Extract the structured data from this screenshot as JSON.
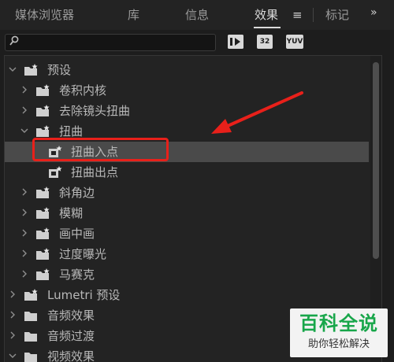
{
  "tabs": [
    {
      "label": "媒体浏览器"
    },
    {
      "label": "库"
    },
    {
      "label": "信息"
    },
    {
      "label": "效果",
      "active": true
    },
    {
      "label": "标记"
    }
  ],
  "icons": {
    "tab_menu": "≡",
    "overflow": "»",
    "search": "⌕",
    "chevron_collapsed": "›",
    "chevron_expanded": "⌄"
  },
  "search": {
    "placeholder": "",
    "value": ""
  },
  "toolbar_buttons": [
    {
      "name": "accelerated-effects-button",
      "label": "▶"
    },
    {
      "name": "32bit-effects-button",
      "label": "32"
    },
    {
      "name": "yuv-effects-button",
      "label": "YUV"
    }
  ],
  "tree": {
    "items": [
      {
        "label": "预设",
        "depth": 0,
        "expanded": true,
        "icon": "preset-folder-icon"
      },
      {
        "label": "卷积内核",
        "depth": 1,
        "expanded": false,
        "icon": "preset-folder-icon"
      },
      {
        "label": "去除镜头扭曲",
        "depth": 1,
        "expanded": false,
        "icon": "preset-folder-icon"
      },
      {
        "label": "扭曲",
        "depth": 1,
        "expanded": true,
        "icon": "preset-folder-icon"
      },
      {
        "label": "扭曲入点",
        "depth": 2,
        "selected": true,
        "icon": "preset-item-icon"
      },
      {
        "label": "扭曲出点",
        "depth": 2,
        "icon": "preset-item-icon"
      },
      {
        "label": "斜角边",
        "depth": 1,
        "expanded": false,
        "icon": "preset-folder-icon"
      },
      {
        "label": "模糊",
        "depth": 1,
        "expanded": false,
        "icon": "preset-folder-icon"
      },
      {
        "label": "画中画",
        "depth": 1,
        "expanded": false,
        "icon": "preset-folder-icon"
      },
      {
        "label": "过度曝光",
        "depth": 1,
        "expanded": false,
        "icon": "preset-folder-icon"
      },
      {
        "label": "马赛克",
        "depth": 1,
        "expanded": false,
        "icon": "preset-folder-icon"
      },
      {
        "label": "Lumetri 预设",
        "depth": 0,
        "expanded": false,
        "icon": "preset-folder-icon"
      },
      {
        "label": "音频效果",
        "depth": 0,
        "expanded": false,
        "icon": "folder-icon"
      },
      {
        "label": "音频过渡",
        "depth": 0,
        "expanded": false,
        "icon": "folder-icon"
      },
      {
        "label": "视频效果",
        "depth": 0,
        "expanded": true,
        "icon": "folder-icon"
      }
    ]
  },
  "colors": {
    "annotation_red": "#e8201a",
    "selection": "#4a4a4a",
    "panel_bg": "#232323",
    "watermark_green": "#18a64a"
  },
  "watermark": {
    "title": "百科全说",
    "subtitle": "助你轻松解决"
  }
}
